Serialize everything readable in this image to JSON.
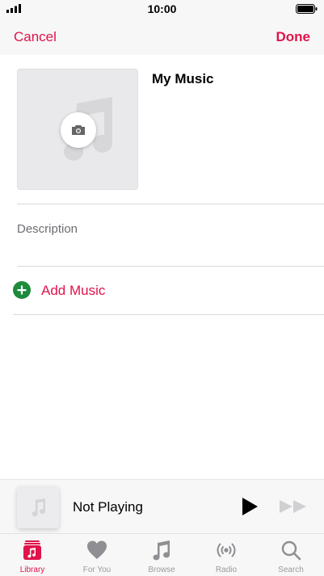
{
  "status_bar": {
    "time": "10:00"
  },
  "nav": {
    "cancel_label": "Cancel",
    "done_label": "Done"
  },
  "playlist": {
    "title": "My Music",
    "description_placeholder": "Description",
    "add_music_label": "Add Music"
  },
  "mini_player": {
    "title": "Not Playing"
  },
  "tabs": [
    {
      "label": "Library",
      "icon": "library-icon",
      "active": true
    },
    {
      "label": "For You",
      "icon": "heart-icon",
      "active": false
    },
    {
      "label": "Browse",
      "icon": "music-note-icon",
      "active": false
    },
    {
      "label": "Radio",
      "icon": "radio-icon",
      "active": false
    },
    {
      "label": "Search",
      "icon": "search-icon",
      "active": false
    }
  ],
  "colors": {
    "accent": "#e0134a",
    "add_green": "#1d8a3c",
    "inactive": "#9a9a9e"
  }
}
